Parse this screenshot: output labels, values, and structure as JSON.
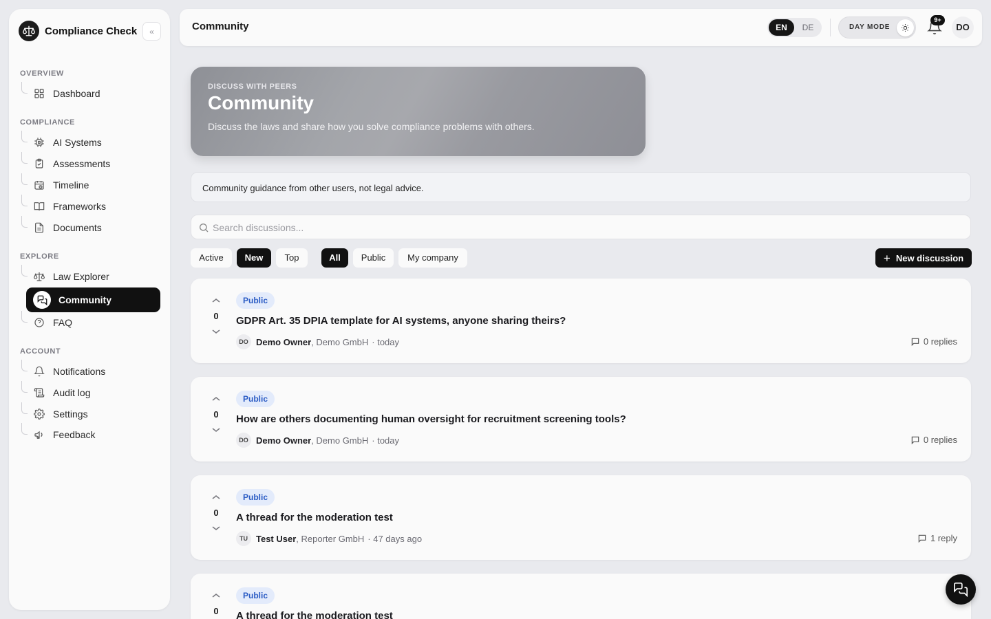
{
  "app": {
    "name": "Compliance Check",
    "collapse_label": "«"
  },
  "sidebar": {
    "sections": [
      {
        "title": "OVERVIEW"
      },
      {
        "title": "COMPLIANCE"
      },
      {
        "title": "EXPLORE"
      },
      {
        "title": "ACCOUNT"
      }
    ],
    "items": [
      {
        "label": "Dashboard",
        "icon": "grid-icon"
      },
      {
        "label": "AI Systems",
        "icon": "chip-icon"
      },
      {
        "label": "Assessments",
        "icon": "clipboard-check-icon"
      },
      {
        "label": "Timeline",
        "icon": "calendar-clock-icon"
      },
      {
        "label": "Frameworks",
        "icon": "book-open-icon"
      },
      {
        "label": "Documents",
        "icon": "file-text-icon"
      },
      {
        "label": "Law Explorer",
        "icon": "scale-icon"
      },
      {
        "label": "Community",
        "icon": "messages-icon",
        "active": true
      },
      {
        "label": "FAQ",
        "icon": "help-circle-icon"
      },
      {
        "label": "Notifications",
        "icon": "bell-icon"
      },
      {
        "label": "Audit log",
        "icon": "scroll-icon"
      },
      {
        "label": "Settings",
        "icon": "gear-icon"
      },
      {
        "label": "Feedback",
        "icon": "megaphone-icon"
      }
    ]
  },
  "topbar": {
    "title": "Community",
    "lang": {
      "active": "EN",
      "other": "DE"
    },
    "mode_label": "DAY MODE",
    "notification_badge": "9+",
    "user_initials": "DO"
  },
  "hero": {
    "kicker": "DISCUSS WITH PEERS",
    "title": "Community",
    "subtitle": "Discuss the laws and share how you solve compliance problems with others."
  },
  "notice": "Community guidance from other users, not legal advice.",
  "search": {
    "placeholder": "Search discussions...",
    "value": ""
  },
  "filters": {
    "sort": [
      {
        "label": "Active",
        "selected": false
      },
      {
        "label": "New",
        "selected": true
      },
      {
        "label": "Top",
        "selected": false
      }
    ],
    "scope": [
      {
        "label": "All",
        "selected": true
      },
      {
        "label": "Public",
        "selected": false
      },
      {
        "label": "My company",
        "selected": false
      }
    ],
    "new_button": "New discussion"
  },
  "threads": [
    {
      "votes": "0",
      "tag": "Public",
      "title": "GDPR Art. 35 DPIA template for AI systems, anyone sharing theirs?",
      "author_initials": "DO",
      "author": "Demo Owner",
      "company": ", Demo GmbH",
      "time": "· today",
      "replies": "0 replies"
    },
    {
      "votes": "0",
      "tag": "Public",
      "title": "How are others documenting human oversight for recruitment screening tools?",
      "author_initials": "DO",
      "author": "Demo Owner",
      "company": ", Demo GmbH",
      "time": "· today",
      "replies": "0 replies"
    },
    {
      "votes": "0",
      "tag": "Public",
      "title": "A thread for the moderation test",
      "author_initials": "TU",
      "author": "Test User",
      "company": ", Reporter GmbH",
      "time": "· 47 days ago",
      "replies": "1 reply"
    },
    {
      "votes": "0",
      "tag": "Public",
      "title": "A thread for the moderation test"
    }
  ],
  "colors": {
    "accent": "#111111",
    "tag_bg": "#e3ebfb",
    "tag_text": "#2a5bc4",
    "background": "#e9eaee"
  }
}
